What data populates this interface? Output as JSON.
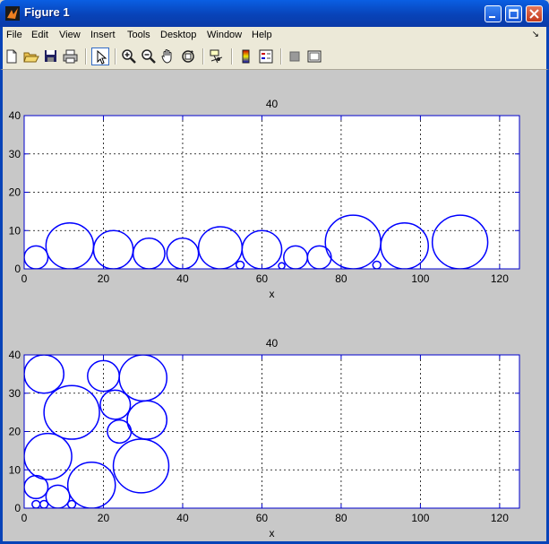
{
  "window": {
    "title": "Figure 1"
  },
  "menu": {
    "items": [
      "File",
      "Edit",
      "View",
      "Insert",
      "Tools",
      "Desktop",
      "Window",
      "Help"
    ],
    "dock": "↘"
  },
  "toolbar": {
    "icons": [
      "new-file-icon",
      "open-file-icon",
      "save-icon",
      "print-icon",
      "edit-plot-arrow-icon",
      "zoom-in-icon",
      "zoom-out-icon",
      "pan-hand-icon",
      "rotate-3d-icon",
      "data-cursor-icon",
      "colorbar-icon",
      "legend-icon",
      "hide-plot-tools-icon",
      "show-plot-tools-icon"
    ]
  },
  "colors": {
    "circle": "#0000ff",
    "axes": "#0000cc",
    "grid": "#000000",
    "plot_bg": "#ffffff",
    "figure_bg": "#c8c8c8"
  },
  "chart_data": [
    {
      "type": "scatter",
      "title": "40",
      "xlabel": "x",
      "ylabel": "",
      "xlim": [
        0,
        125
      ],
      "ylim": [
        0,
        40
      ],
      "xticks": [
        "0",
        "20",
        "40",
        "60",
        "80",
        "100",
        "120"
      ],
      "yticks": [
        "0",
        "10",
        "20",
        "30",
        "40"
      ],
      "grid": true,
      "circles": [
        {
          "x": 3,
          "y": 3,
          "r": 3
        },
        {
          "x": 11.5,
          "y": 6,
          "r": 6
        },
        {
          "x": 22.5,
          "y": 5,
          "r": 5
        },
        {
          "x": 31.5,
          "y": 4,
          "r": 4
        },
        {
          "x": 40,
          "y": 4,
          "r": 4
        },
        {
          "x": 49.5,
          "y": 5.5,
          "r": 5.5
        },
        {
          "x": 54.5,
          "y": 1,
          "r": 1
        },
        {
          "x": 60,
          "y": 5,
          "r": 5
        },
        {
          "x": 65,
          "y": 0.8,
          "r": 0.8
        },
        {
          "x": 68.5,
          "y": 3,
          "r": 3
        },
        {
          "x": 74.5,
          "y": 3,
          "r": 3
        },
        {
          "x": 83,
          "y": 7,
          "r": 7
        },
        {
          "x": 89,
          "y": 1,
          "r": 1
        },
        {
          "x": 96,
          "y": 6,
          "r": 6
        },
        {
          "x": 110,
          "y": 7,
          "r": 7
        }
      ]
    },
    {
      "type": "scatter",
      "title": "40",
      "xlabel": "x",
      "ylabel": "",
      "xlim": [
        0,
        125
      ],
      "ylim": [
        0,
        40
      ],
      "xticks": [
        "0",
        "20",
        "40",
        "60",
        "80",
        "100",
        "120"
      ],
      "yticks": [
        "0",
        "10",
        "20",
        "30",
        "40"
      ],
      "grid": true,
      "circles": [
        {
          "x": 5,
          "y": 35,
          "r": 5
        },
        {
          "x": 20,
          "y": 34.5,
          "r": 4
        },
        {
          "x": 30,
          "y": 34,
          "r": 6
        },
        {
          "x": 12,
          "y": 25,
          "r": 7
        },
        {
          "x": 23,
          "y": 27,
          "r": 3.8
        },
        {
          "x": 31,
          "y": 23,
          "r": 5
        },
        {
          "x": 24,
          "y": 20,
          "r": 3
        },
        {
          "x": 6,
          "y": 13.5,
          "r": 6
        },
        {
          "x": 29.5,
          "y": 11,
          "r": 7
        },
        {
          "x": 3,
          "y": 5.5,
          "r": 3
        },
        {
          "x": 3,
          "y": 1,
          "r": 1
        },
        {
          "x": 5,
          "y": 1,
          "r": 1
        },
        {
          "x": 8.5,
          "y": 3,
          "r": 3
        },
        {
          "x": 12,
          "y": 1,
          "r": 1
        },
        {
          "x": 17,
          "y": 6,
          "r": 6
        }
      ]
    }
  ]
}
